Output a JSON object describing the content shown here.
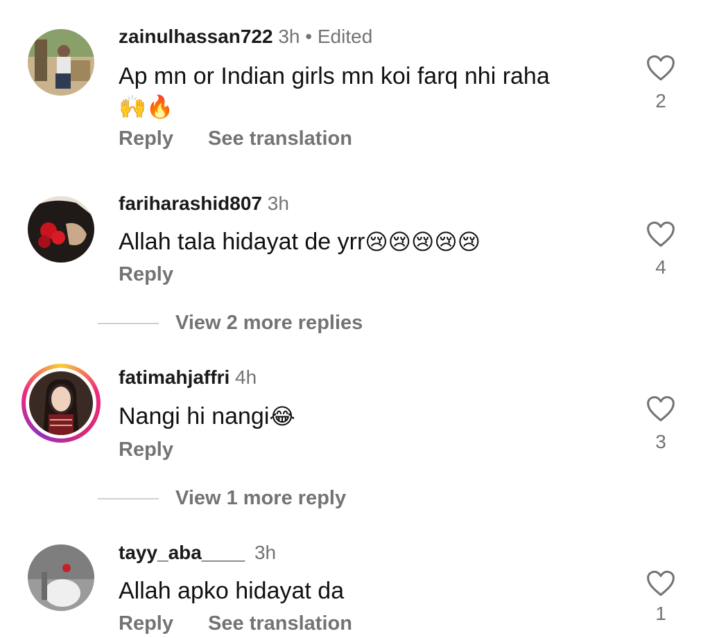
{
  "comments": [
    {
      "username": "zainulhassan722",
      "time": "3h",
      "edited": "Edited",
      "text": "Ap mn  or Indian girls mn koi farq nhi raha",
      "emojis": "🙌🔥",
      "reply_label": "Reply",
      "translation_label": "See translation",
      "likes": "2"
    },
    {
      "username": "fariharashid807",
      "time": "3h",
      "text": "Allah tala hidayat de yrr",
      "emojis": "😢😢😢😢😢",
      "reply_label": "Reply",
      "likes": "4",
      "view_more": "View 2 more replies"
    },
    {
      "username": "fatimahjaffri",
      "time": "4h",
      "text": "Nangi hi nangi",
      "emojis": "😂",
      "reply_label": "Reply",
      "likes": "3",
      "view_more": "View 1 more reply"
    },
    {
      "username": "tayy_aba____",
      "time": "3h",
      "text": "Allah apko hidayat da",
      "reply_label": "Reply",
      "translation_label": "See translation",
      "likes": "1"
    }
  ],
  "icons": {
    "like": "heart-outline-icon"
  },
  "colors": {
    "secondary_text": "#737373",
    "primary_text": "#111111",
    "story_ring_start": "#f9ce34",
    "story_ring_mid": "#ee2a7b",
    "story_ring_end": "#962fbf"
  }
}
